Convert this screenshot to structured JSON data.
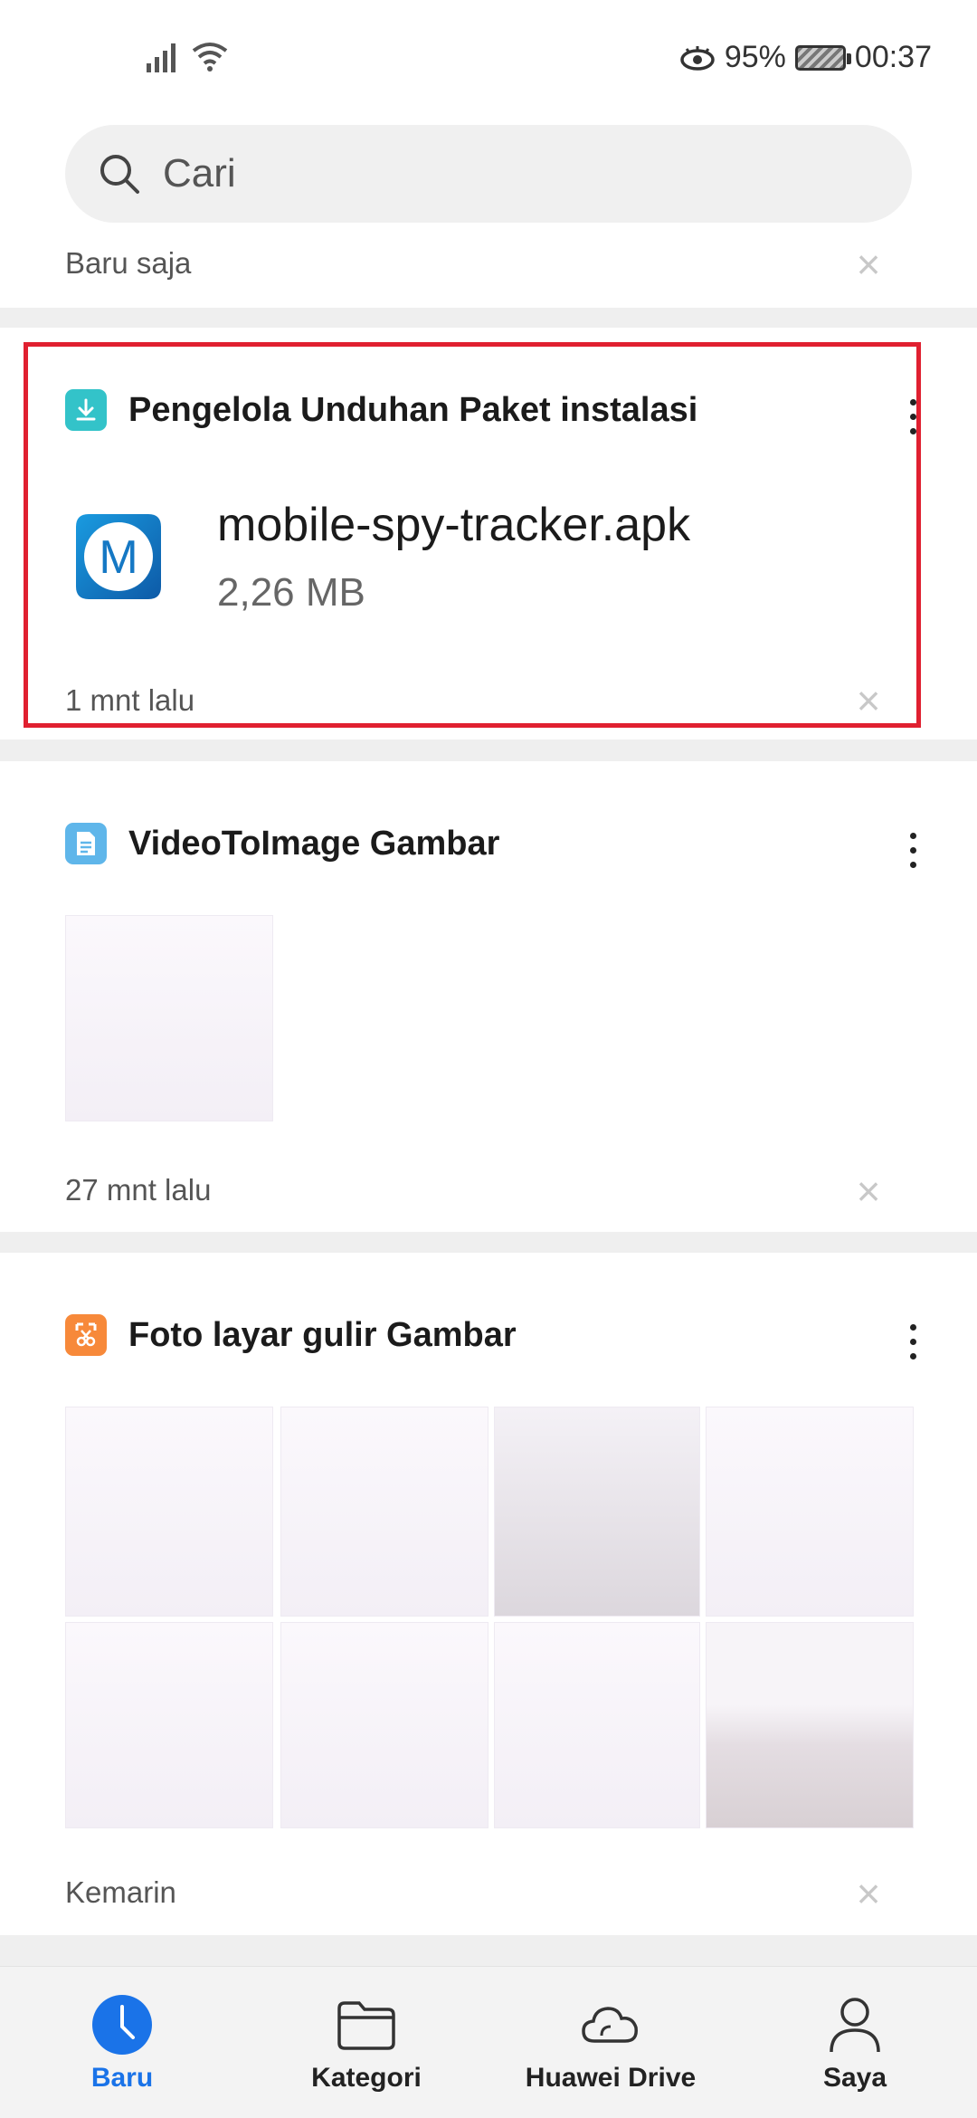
{
  "status_bar": {
    "battery_percent": "95%",
    "time": "00:37"
  },
  "search": {
    "placeholder": "Cari"
  },
  "sections": {
    "recent_label": "Baru saja"
  },
  "cards": [
    {
      "app": "Pengelola Unduhan",
      "category": "Paket instalasi",
      "file_name": "mobile-spy-tracker.apk",
      "file_size": "2,26 MB",
      "time": "1 mnt lalu"
    },
    {
      "app": "VideoToImage",
      "category": "Gambar",
      "time": "27 mnt lalu"
    },
    {
      "app": "Foto layar gulir",
      "category": "Gambar",
      "time": "Kemarin"
    }
  ],
  "bottom_nav": [
    {
      "label": "Baru",
      "active": true
    },
    {
      "label": "Kategori",
      "active": false
    },
    {
      "label": "Huawei Drive",
      "active": false
    },
    {
      "label": "Saya",
      "active": false
    }
  ],
  "colors": {
    "accent": "#1a73e8",
    "highlight_border": "#e02030",
    "download_icon": "#33c3c9",
    "doc_icon": "#5fb6ea",
    "screenshot_icon": "#f7893a"
  }
}
